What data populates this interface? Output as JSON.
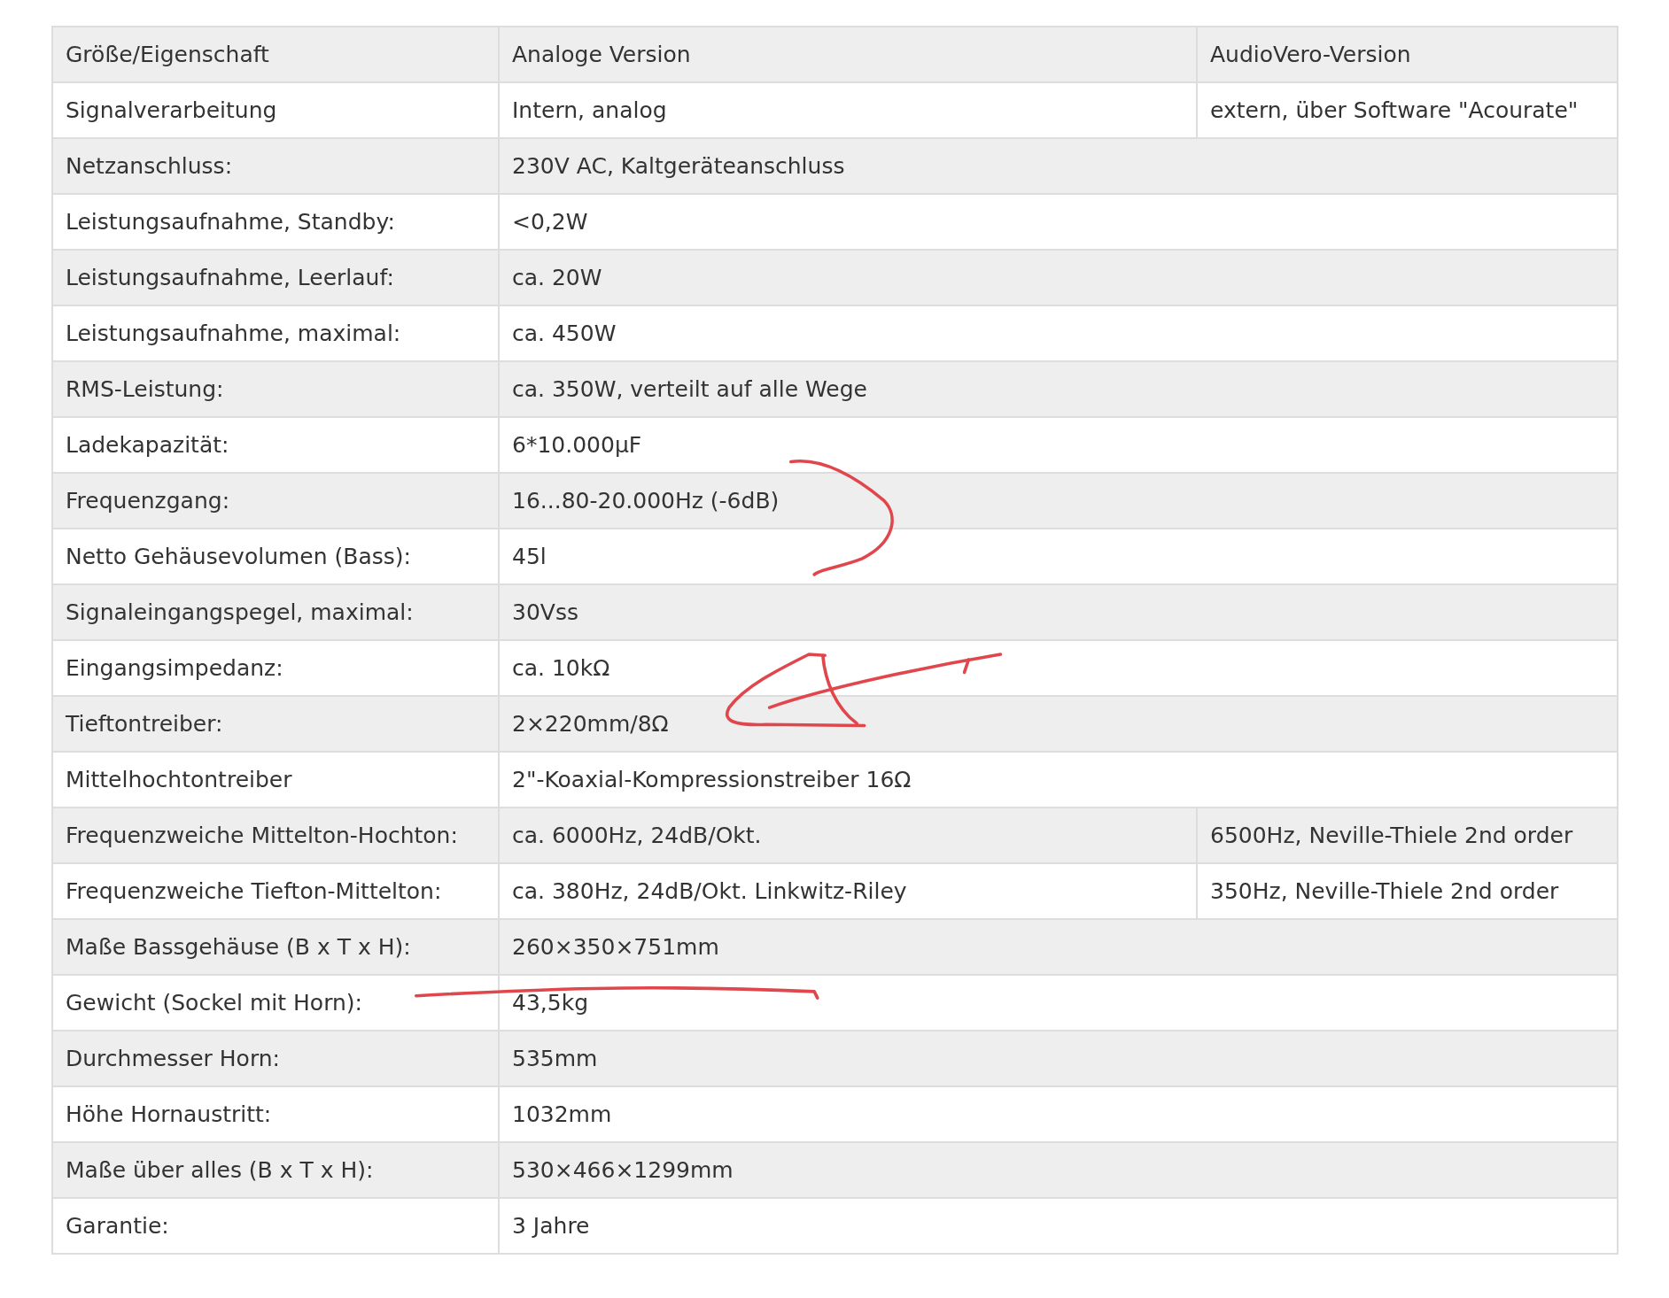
{
  "table": {
    "columns": [
      "Größe/Eigenschaft",
      "Analoge Version",
      "AudioVero-Version"
    ],
    "rows": [
      {
        "cells": [
          "Signalverarbeitung",
          "Intern, analog",
          "extern, über Software \"Acourate\""
        ]
      },
      {
        "cells": [
          "Netzanschluss:",
          {
            "text": "230V AC, Kaltgeräteanschluss",
            "colspan": 2
          }
        ]
      },
      {
        "cells": [
          "Leistungsaufnahme, Standby:",
          {
            "text": "<0,2W",
            "colspan": 2
          }
        ]
      },
      {
        "cells": [
          "Leistungsaufnahme, Leerlauf:",
          {
            "text": "ca. 20W",
            "colspan": 2
          }
        ]
      },
      {
        "cells": [
          "Leistungsaufnahme, maximal:",
          {
            "text": "ca. 450W",
            "colspan": 2
          }
        ]
      },
      {
        "cells": [
          "RMS-Leistung:",
          {
            "text": "ca. 350W, verteilt auf alle Wege",
            "colspan": 2
          }
        ]
      },
      {
        "cells": [
          "Ladekapazität:",
          {
            "text": "6*10.000µF",
            "colspan": 2
          }
        ]
      },
      {
        "cells": [
          "Frequenzgang:",
          {
            "text": "16...80-20.000Hz (-6dB)",
            "colspan": 2
          }
        ]
      },
      {
        "cells": [
          "Netto Gehäusevolumen (Bass):",
          {
            "text": "45l",
            "colspan": 2
          }
        ]
      },
      {
        "cells": [
          "Signaleingangspegel, maximal:",
          {
            "text": "30Vss",
            "colspan": 2
          }
        ]
      },
      {
        "cells": [
          "Eingangsimpedanz:",
          {
            "text": "ca. 10kΩ",
            "colspan": 2
          }
        ]
      },
      {
        "cells": [
          "Tieftontreiber:",
          {
            "text": "2×220mm/8Ω",
            "colspan": 2
          }
        ]
      },
      {
        "cells": [
          "Mittelhochtontreiber",
          {
            "text": "2\"-Koaxial-Kompressionstreiber 16Ω",
            "colspan": 2
          }
        ]
      },
      {
        "cells": [
          "Frequenzweiche Mittelton-Hochton:",
          "ca. 6000Hz, 24dB/Okt.",
          "6500Hz, Neville-Thiele 2nd order"
        ]
      },
      {
        "cells": [
          "Frequenzweiche Tiefton-Mittelton:",
          "ca. 380Hz, 24dB/Okt. Linkwitz-Riley",
          "350Hz, Neville-Thiele 2nd order"
        ]
      },
      {
        "cells": [
          "Maße Bassgehäuse (B x T x H):",
          {
            "text": "260×350×751mm",
            "colspan": 2
          }
        ]
      },
      {
        "cells": [
          "Gewicht (Sockel mit Horn):",
          {
            "text": "43,5kg",
            "colspan": 2
          }
        ]
      },
      {
        "cells": [
          "Durchmesser Horn:",
          {
            "text": "535mm",
            "colspan": 2
          }
        ]
      },
      {
        "cells": [
          "Höhe Hornaustritt:",
          {
            "text": "1032mm",
            "colspan": 2
          }
        ]
      },
      {
        "cells": [
          "Maße über alles (B x T x H):",
          {
            "text": "530×466×1299mm",
            "colspan": 2
          }
        ]
      },
      {
        "cells": [
          "Garantie:",
          {
            "text": "3 Jahre",
            "colspan": 2
          }
        ]
      }
    ]
  }
}
